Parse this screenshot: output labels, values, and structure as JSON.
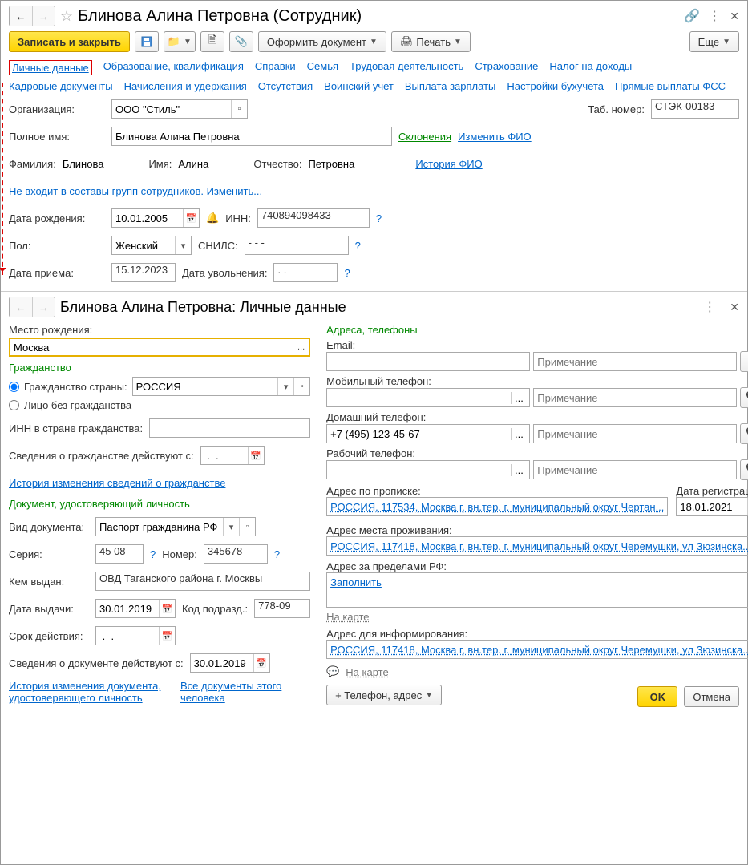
{
  "top": {
    "title": "Блинова Алина Петровна (Сотрудник)",
    "toolbar": {
      "save_close": "Записать и закрыть",
      "format_doc": "Оформить документ",
      "print": "Печать",
      "more": "Еще"
    },
    "tabs1": [
      "Личные данные",
      "Образование, квалификация",
      "Справки",
      "Семья",
      "Трудовая деятельность",
      "Страхование",
      "Налог на доходы"
    ],
    "tabs2": [
      "Кадровые документы",
      "Начисления и удержания",
      "Отсутствия",
      "Воинский учет",
      "Выплата зарплаты",
      "Настройки бухучета",
      "Прямые выплаты ФСС"
    ],
    "labels": {
      "org": "Организация:",
      "tabnum": "Таб. номер:",
      "fullname": "Полное имя:",
      "declension": "Склонения",
      "change_fio": "Изменить ФИО",
      "lastname": "Фамилия:",
      "firstname": "Имя:",
      "patronymic": "Отчество:",
      "history_fio": "История ФИО",
      "groups_link": "Не входит в составы групп сотрудников. Изменить...",
      "birth": "Дата рождения:",
      "inn": "ИНН:",
      "gender": "Пол:",
      "snils": "СНИЛС:",
      "hire": "Дата приема:",
      "fire": "Дата увольнения:"
    },
    "values": {
      "org": "ООО \"Стиль\"",
      "tabnum": "СТЭК-00183",
      "fullname": "Блинова Алина Петровна",
      "lastname": "Блинова",
      "firstname": "Алина",
      "patronymic": "Петровна",
      "birth": "10.01.2005",
      "inn": "740894098433",
      "gender": "Женский",
      "snils": "-   -   -",
      "hire": "15.12.2023",
      "fire": " .  ."
    }
  },
  "detail": {
    "title": "Блинова Алина Петровна: Личные данные",
    "left": {
      "birthplace_lbl": "Место рождения:",
      "birthplace": "Москва",
      "citizenship_hdr": "Гражданство",
      "radio_country": "Гражданство страны:",
      "radio_stateless": "Лицо без гражданства",
      "country": "РОССИЯ",
      "inn_country_lbl": "ИНН в стране гражданства:",
      "citiz_from_lbl": "Сведения о гражданстве действуют с:",
      "citiz_from": " .  .",
      "citiz_history": "История изменения сведений о гражданстве",
      "iddoc_hdr": "Документ, удостоверяющий личность",
      "doctype_lbl": "Вид документа:",
      "doctype": "Паспорт гражданина РФ",
      "series_lbl": "Серия:",
      "series": "45 08",
      "number_lbl": "Номер:",
      "number": "345678",
      "issued_by_lbl": "Кем выдан:",
      "issued_by": "ОВД Таганского района г. Москвы",
      "issued_date_lbl": "Дата выдачи:",
      "issued_date": "30.01.2019",
      "dept_code_lbl": "Код подразд.:",
      "dept_code": "778-09",
      "expiry_lbl": "Срок действия:",
      "expiry": " .  .",
      "doc_from_lbl": "Сведения о документе действуют с:",
      "doc_from": "30.01.2019",
      "doc_history": "История изменения документа, удостоверяющего личность",
      "all_docs": "Все документы этого человека"
    },
    "right": {
      "addr_hdr": "Адреса, телефоны",
      "email_lbl": "Email:",
      "mobile_lbl": "Мобильный телефон:",
      "home_lbl": "Домашний телефон:",
      "home_phone": "+7 (495) 123-45-67",
      "work_lbl": "Рабочий телефон:",
      "note_ph": "Примечание",
      "reg_addr_lbl": "Адрес по прописке:",
      "reg_date_lbl": "Дата регистрации:",
      "reg_addr": "РОССИЯ, 117534, Москва г, вн.тер. г. муниципальный округ Чертан...",
      "reg_date": "18.01.2021",
      "live_addr_lbl": "Адрес места проживания:",
      "live_addr": "РОССИЯ, 117418, Москва г, вн.тер. г. муниципальный округ Черемушки, ул Зюзинска...",
      "foreign_addr_lbl": "Адрес за пределами РФ:",
      "fill_link": "Заполнить",
      "on_map": "На карте",
      "inform_addr_lbl": "Адрес для информирования:",
      "inform_addr": "РОССИЯ, 117418, Москва г, вн.тер. г. муниципальный округ Черемушки, ул Зюзинска...",
      "add_phone_btn": "+ Телефон, адрес"
    },
    "footer": {
      "ok": "OK",
      "cancel": "Отмена"
    }
  }
}
